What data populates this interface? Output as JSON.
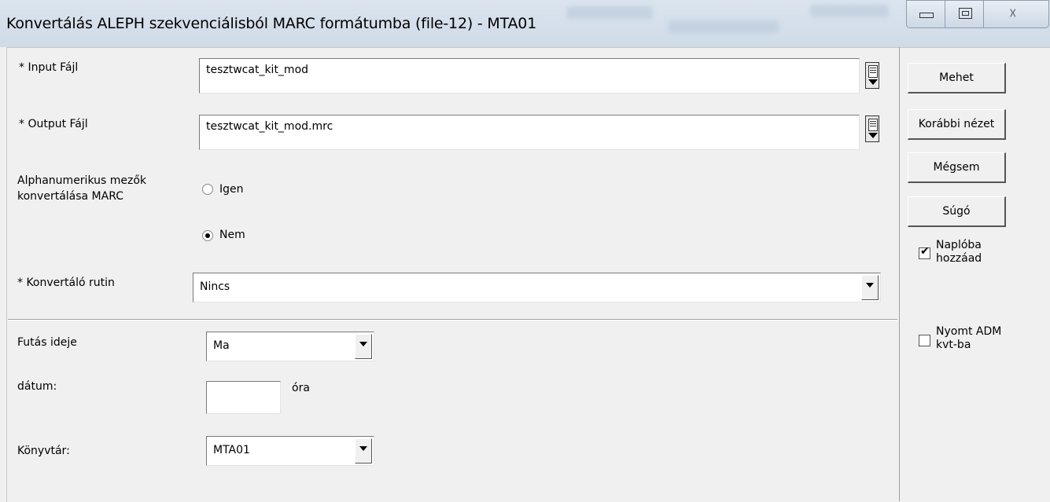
{
  "window": {
    "title": "Konvertálás ALEPH szekvenciálisból MARC formátumba (file-12) - MTA01"
  },
  "form": {
    "input_label": "* Input Fájl",
    "input_value": "tesztwcat_kit_mod",
    "output_label": "* Output Fájl",
    "output_value": "tesztwcat_kit_mod.mrc",
    "alpha_label_line1": "Alphanumerikus mezők",
    "alpha_label_line2": "konvertálása MARC",
    "radio_yes_label": "Igen",
    "radio_no_label": "Nem",
    "radio_selected": "Nem",
    "routine_label": "* Konvertáló rutin",
    "routine_value": "Nincs",
    "runtime_label": "Futás ideje",
    "runtime_value": "Ma",
    "date_label": "dátum:",
    "date_value": "",
    "hour_label": "óra",
    "library_label": "Könyvtár:",
    "library_value": "MTA01"
  },
  "actions": {
    "run_label": "Mehet",
    "previous_view_label": "Korábbi nézet",
    "cancel_label": "Mégsem",
    "help_label": "Súgó",
    "log_checkbox_label": "Naplóba hozzáad",
    "log_checked": true,
    "print_checkbox_label": "Nyomt ADM kvt-ba",
    "print_checked": false
  },
  "icons": {
    "minimize": "minimize-icon",
    "maximize": "maximize-icon",
    "close": "close-icon",
    "close_glyph": "☓",
    "check_glyph": "✔",
    "browse": "file-browse-icon",
    "dropdown": "chevron-down-icon"
  }
}
